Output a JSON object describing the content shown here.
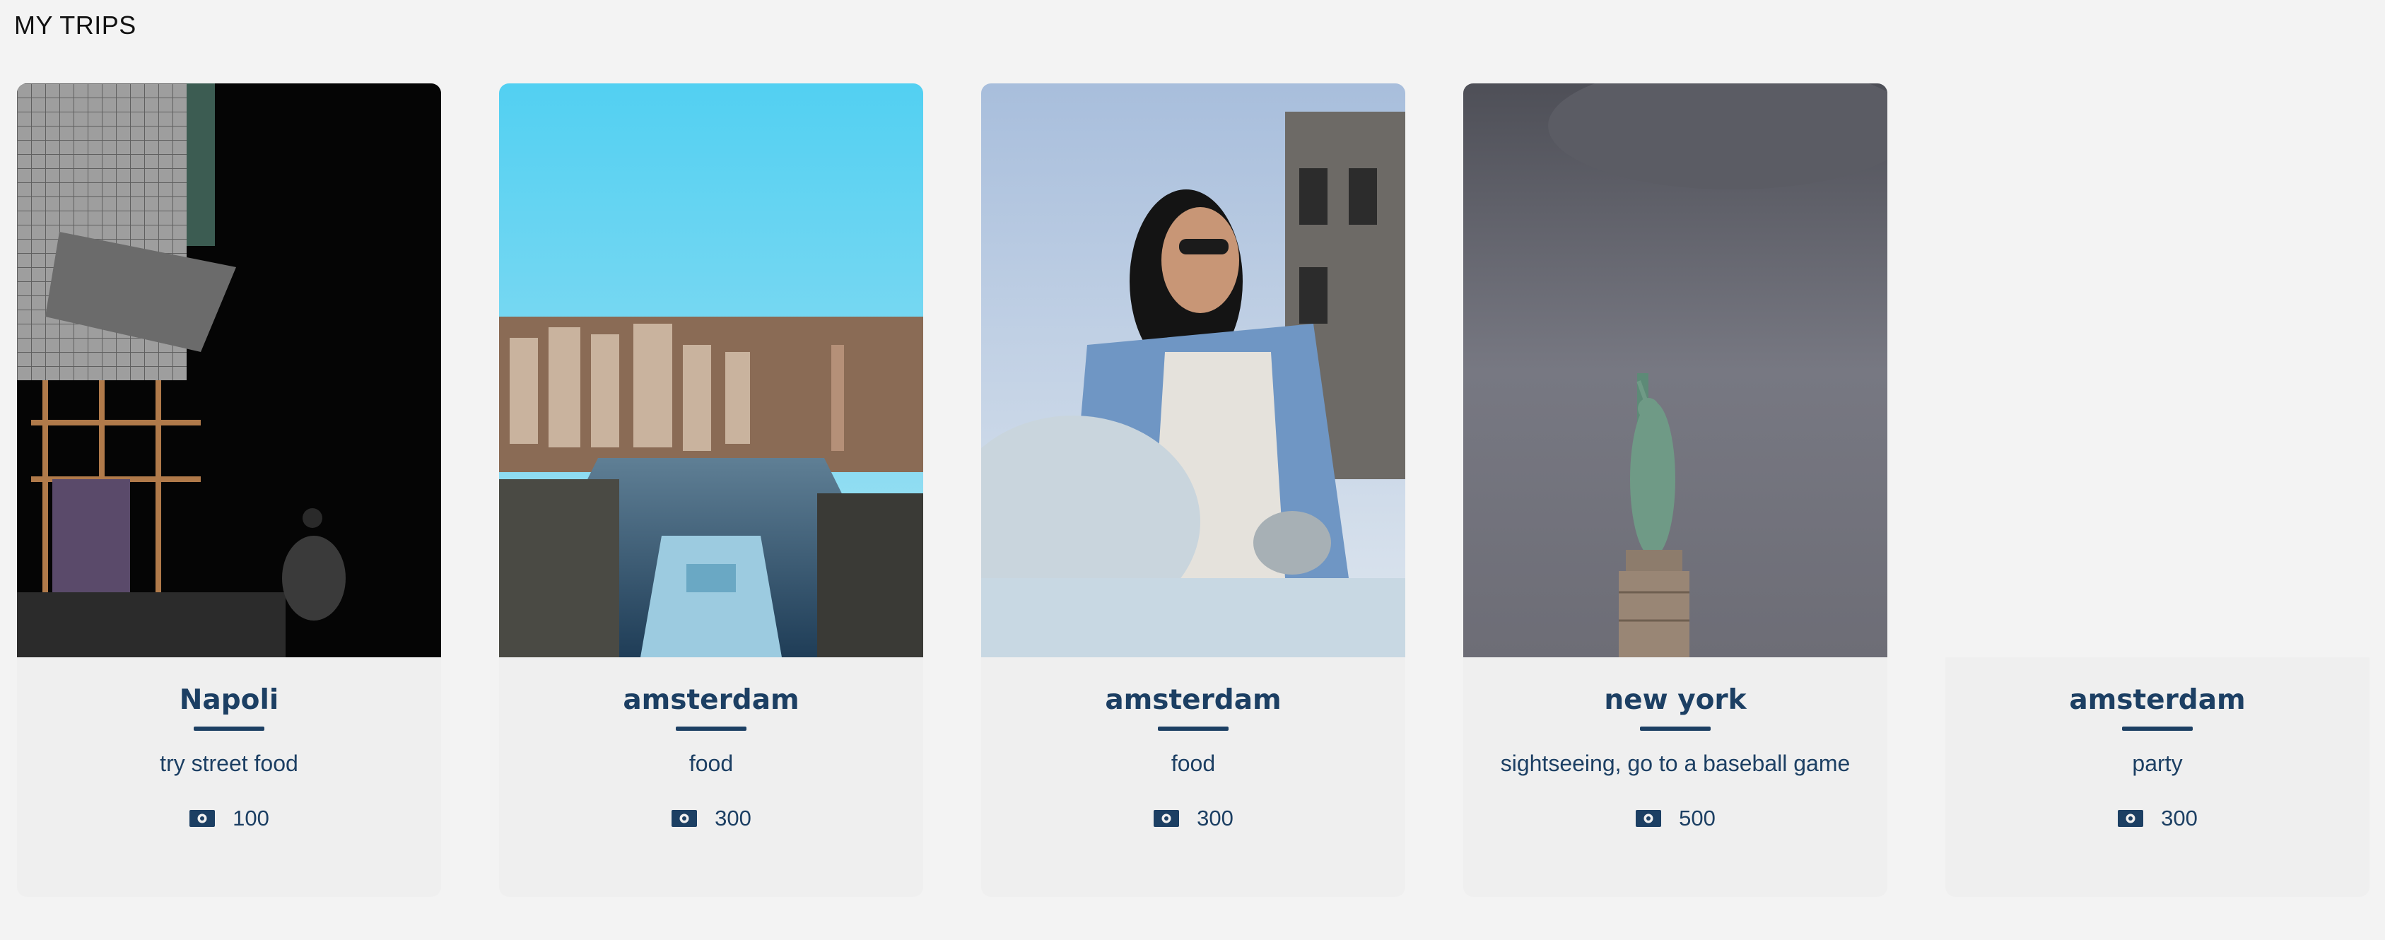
{
  "page": {
    "title": "MY TRIPS"
  },
  "trips": [
    {
      "name": "Napoli",
      "description": "try street food",
      "budget": "100",
      "image": "scaffolding-street-photo",
      "budget_icon": "money-icon"
    },
    {
      "name": "amsterdam",
      "description": "food",
      "budget": "300",
      "image": "amsterdam-canal-photo",
      "budget_icon": "money-icon"
    },
    {
      "name": "amsterdam",
      "description": "food",
      "budget": "300",
      "image": "woman-sunglasses-car-photo",
      "budget_icon": "money-icon"
    },
    {
      "name": "new york",
      "description": "sightseeing, go to a baseball game",
      "budget": "500",
      "image": "statue-of-liberty-photo",
      "budget_icon": "money-icon"
    },
    {
      "name": "amsterdam",
      "description": "party",
      "budget": "300",
      "image": "",
      "budget_icon": "money-icon"
    }
  ],
  "colors": {
    "background": "#f3f3f3",
    "card_body": "#efefef",
    "accent": "#1c3f63"
  }
}
